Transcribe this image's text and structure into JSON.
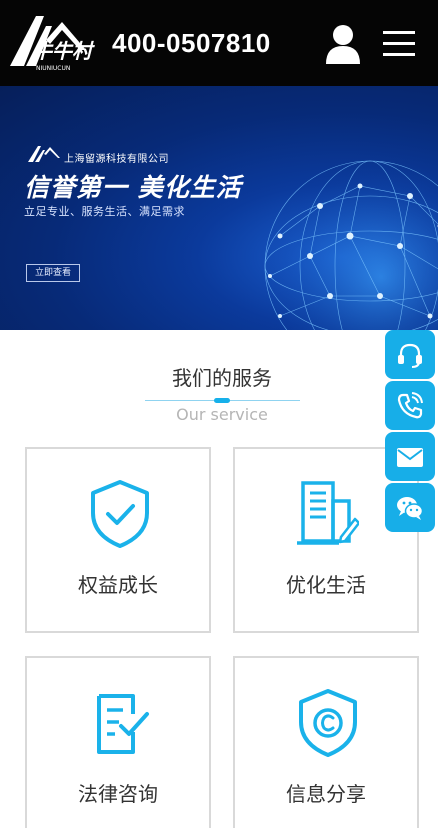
{
  "header": {
    "logo_text": "牛牛村",
    "logo_subtext": "NIUNIUCUN",
    "phone": "400-0507810",
    "user_icon": "user-icon",
    "menu_icon": "menu-icon"
  },
  "banner": {
    "company": "上海留源科技有限公司",
    "title": "信誉第一  美化生活",
    "subtitle": "立足专业、服务生活、满足需求",
    "button_label": "立即查看"
  },
  "services": {
    "title": "我们的服务",
    "subtitle": "Our service",
    "items": [
      {
        "label": "权益成长",
        "icon": "shield-check-icon"
      },
      {
        "label": "优化生活",
        "icon": "building-pencil-icon"
      },
      {
        "label": "法律咨询",
        "icon": "document-check-icon"
      },
      {
        "label": "信息分享",
        "icon": "copyright-shield-icon"
      }
    ]
  },
  "side_buttons": [
    {
      "icon": "headset-icon"
    },
    {
      "icon": "phone-icon"
    },
    {
      "icon": "mail-icon"
    },
    {
      "icon": "wechat-icon"
    }
  ],
  "colors": {
    "accent": "#17aee8",
    "header_bg": "#050505",
    "banner_bg": "#0b3a9c"
  }
}
